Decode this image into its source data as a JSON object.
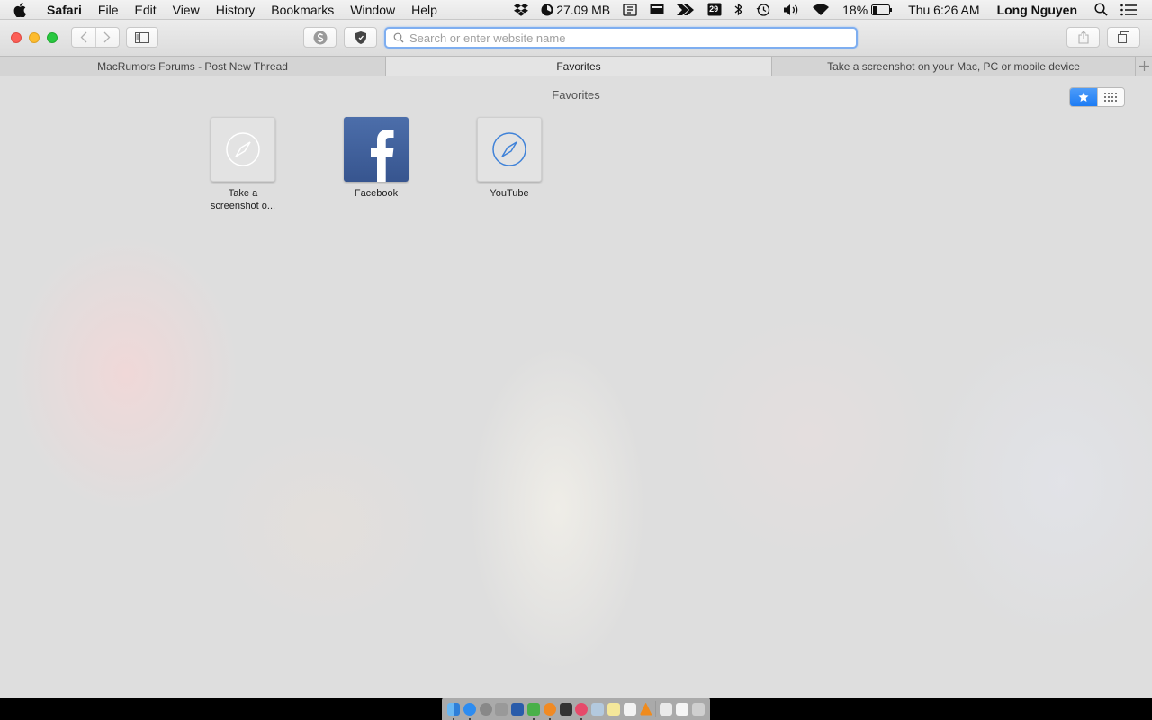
{
  "menubar": {
    "app": "Safari",
    "menus": [
      "File",
      "Edit",
      "View",
      "History",
      "Bookmarks",
      "Window",
      "Help"
    ],
    "memory": "27.09 MB",
    "calendar_day": "29",
    "battery": "18%",
    "clock": "Thu 6:26 AM",
    "user": "Long Nguyen",
    "icons": [
      "apple-icon",
      "dropbox-icon",
      "memory-gauge-icon",
      "screen-icon",
      "display-icon",
      "plane-icon",
      "calendar-icon",
      "bluetooth-icon",
      "time-machine-icon",
      "volume-icon",
      "wifi-icon",
      "battery-icon",
      "spotlight-icon",
      "notification-list-icon"
    ]
  },
  "toolbar": {
    "url_placeholder": "Search or enter website name"
  },
  "tabs": [
    {
      "label": "MacRumors Forums - Post New Thread",
      "active": false
    },
    {
      "label": "Favorites",
      "active": true
    },
    {
      "label": "Take a screenshot on your Mac, PC or mobile device",
      "active": false
    }
  ],
  "content": {
    "title": "Favorites",
    "favorites": [
      {
        "line1": "Take a",
        "line2": "screenshot o...",
        "icon": "compass-icon"
      },
      {
        "line1": "Facebook",
        "line2": "",
        "icon": "facebook-icon"
      },
      {
        "line1": "YouTube",
        "line2": "",
        "icon": "compass-icon"
      }
    ]
  },
  "colors": {
    "accent": "#1d7cf4",
    "facebook": "#3b5998"
  }
}
